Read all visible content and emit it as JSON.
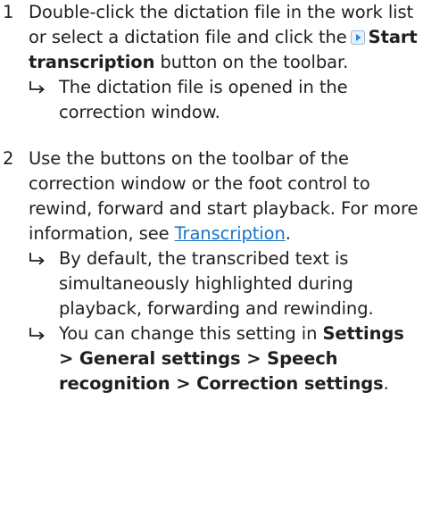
{
  "steps": [
    {
      "number": "1",
      "text_before_icon": "Double-click the dictation file in the work list or select a dictation file and click the",
      "button_label": "Start transcription",
      "text_after_button": " button on the toolbar.",
      "icon": "play-icon",
      "results": [
        "The dictation file is opened in the correction window."
      ]
    },
    {
      "number": "2",
      "text_before_link": "Use the buttons on the toolbar of the correction window or the foot control to rewind, forward and start playback. For more information, see ",
      "link_label": "Transcription",
      "text_after_link": ".",
      "results": [
        "By default, the transcribed text is simultaneously highlighted during playback, forwarding and rewinding.",
        "You can change this setting in"
      ],
      "settings_path": "Settings > General settings > Speech recognition > Correction settings",
      "settings_suffix": "."
    }
  ],
  "colors": {
    "text": "#1f1f1f",
    "link": "#1a73c8",
    "icon_accent": "#1e88e5"
  }
}
